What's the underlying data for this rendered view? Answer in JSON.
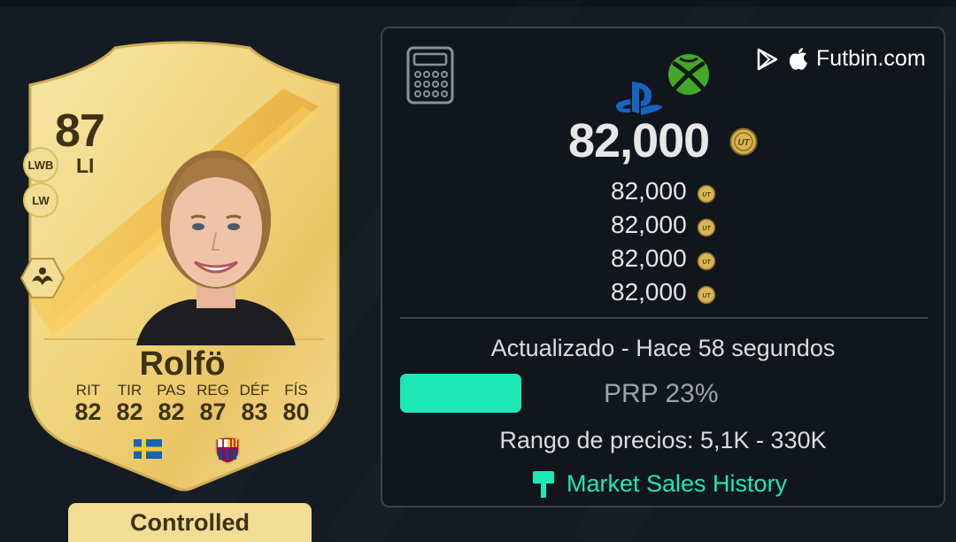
{
  "card": {
    "rating": "87",
    "position": "LI",
    "alt_positions": [
      "LWB",
      "LW"
    ],
    "name": "Rolfö",
    "stats": [
      {
        "label": "RIT",
        "value": "82"
      },
      {
        "label": "TIR",
        "value": "82"
      },
      {
        "label": "PAS",
        "value": "82"
      },
      {
        "label": "REG",
        "value": "87"
      },
      {
        "label": "DÉF",
        "value": "83"
      },
      {
        "label": "FÍS",
        "value": "80"
      }
    ],
    "nation_icon": "sweden-flag-icon",
    "club_icon": "fc-barcelona-crest-icon"
  },
  "controlled_label": "Controlled",
  "price_panel": {
    "brand": "Futbin.com",
    "main_price": "82,000",
    "sub_prices": [
      "82,000",
      "82,000",
      "82,000",
      "82,000"
    ],
    "updated": "Actualizado - Hace 58 segundos",
    "prp_label": "PRP 23%",
    "prp_percent": 23,
    "range": "Rango de precios: 5,1K - 330K",
    "market_sales_history": "Market Sales History"
  },
  "colors": {
    "accent": "#1de9b6",
    "card_gold": "#f1dd93",
    "card_text": "#3e3216",
    "panel_bg": "#10161c",
    "page_bg": "#141b22"
  }
}
